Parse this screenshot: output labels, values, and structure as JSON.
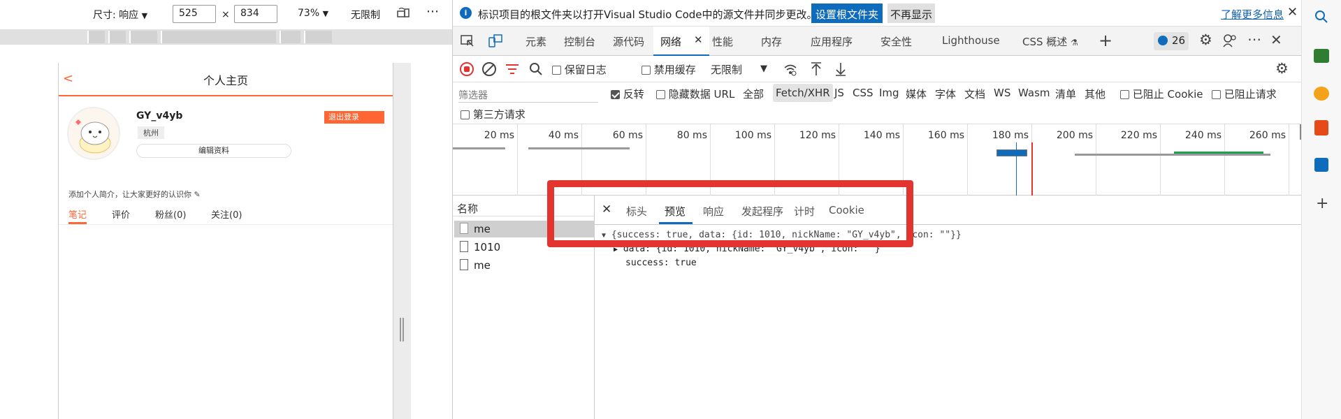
{
  "device_toolbar": {
    "dimensions_label": "尺寸: 响应",
    "width_value": "525",
    "times": "×",
    "height_value": "834",
    "zoom": "73%",
    "throttle": "无限制",
    "more": "⋮"
  },
  "phone": {
    "header_title": "个人主页",
    "back": "<",
    "username": "GY_v4yb",
    "city": "杭州",
    "logout_button": "退出登录",
    "edit_button": "编辑资料",
    "intro_hint": "添加个人简介，让大家更好的认识你 ✎",
    "tabs": [
      "笔记",
      "评价",
      "粉丝(0)",
      "关注(0)"
    ]
  },
  "infobar": {
    "message": "标识项目的根文件夹以打开Visual Studio Code中的源文件并同步更改。",
    "set_root_button": "设置根文件夹",
    "dont_show_button": "不再显示",
    "learn_more": "了解更多信息"
  },
  "devtools_tabs": [
    "元素",
    "控制台",
    "源代码",
    "网络",
    "性能",
    "内存",
    "应用程序",
    "安全性",
    "Lighthouse",
    "CSS 概述"
  ],
  "issues_count": "26",
  "network_toolbar": {
    "preserve_log": "保留日志",
    "disable_cache": "禁用缓存",
    "throttle": "无限制"
  },
  "filter_bar": {
    "filter_placeholder": "筛选器",
    "invert": "反转",
    "hide_data_urls": "隐藏数据 URL",
    "types": [
      "全部",
      "Fetch/XHR",
      "JS",
      "CSS",
      "Img",
      "媒体",
      "字体",
      "文档",
      "WS",
      "Wasm",
      "清单",
      "其他"
    ],
    "blocked_cookies": "已阻止 Cookie",
    "blocked_requests": "已阻止请求",
    "third_party": "第三方请求"
  },
  "timeline_ticks": [
    "20 ms",
    "40 ms",
    "60 ms",
    "80 ms",
    "100 ms",
    "120 ms",
    "140 ms",
    "160 ms",
    "180 ms",
    "200 ms",
    "220 ms",
    "240 ms",
    "260 ms"
  ],
  "requests": {
    "header": "名称",
    "items": [
      "me",
      "1010",
      "me"
    ]
  },
  "preview_tabs": [
    "标头",
    "预览",
    "响应",
    "发起程序",
    "计时",
    "Cookie"
  ],
  "preview": {
    "summary": "{success: true, data: {id: 1010, nickName: \"GY_v4yb\", icon: \"\"}}",
    "data_line": "data: {id: 1010, nickName: \"GY_v4yb\", icon: \"\"}",
    "success_line": "success: true"
  },
  "colors": {
    "accent_orange": "#ff6633",
    "highlight_red": "#e3342f",
    "edge_blue": "#0f6cbd"
  }
}
